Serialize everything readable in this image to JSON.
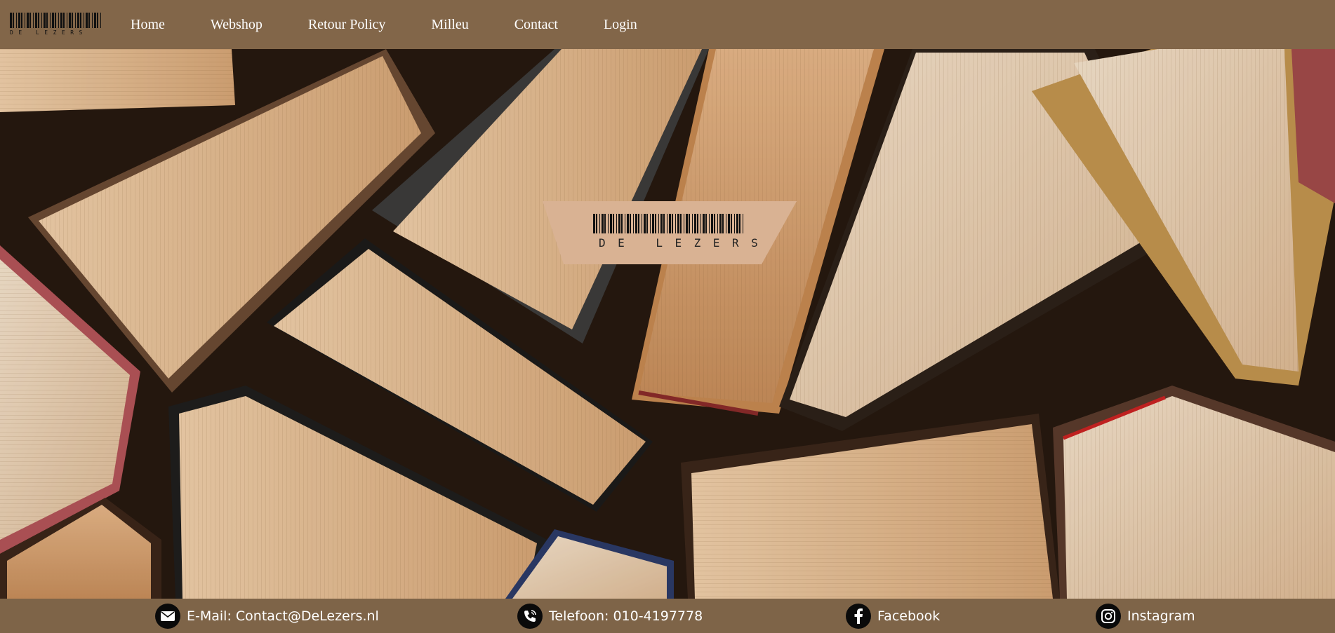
{
  "brand": {
    "name": "DE LEZERS"
  },
  "nav": {
    "items": [
      {
        "label": "Home",
        "id": "home"
      },
      {
        "label": "Webshop",
        "id": "webshop"
      },
      {
        "label": "Retour Policy",
        "id": "retour-policy"
      },
      {
        "label": "Milleu",
        "id": "milleu"
      },
      {
        "label": "Contact",
        "id": "contact"
      },
      {
        "label": "Login",
        "id": "login"
      }
    ]
  },
  "hero": {
    "badge_text": "DE LEZERS",
    "image_subject": "open-books-background"
  },
  "footer": {
    "email": {
      "label": "E-Mail: Contact@DeLezers.nl",
      "icon": "envelope-icon"
    },
    "phone": {
      "label": "Telefoon: 010-4197778",
      "icon": "phone-icon"
    },
    "facebook": {
      "label": "Facebook",
      "icon": "facebook-icon"
    },
    "instagram": {
      "label": "Instagram",
      "icon": "instagram-icon"
    }
  },
  "colors": {
    "nav_background": "#826649",
    "footer_background": "#7e6448",
    "badge_background": "#d9b293",
    "text": "#ffffff"
  }
}
